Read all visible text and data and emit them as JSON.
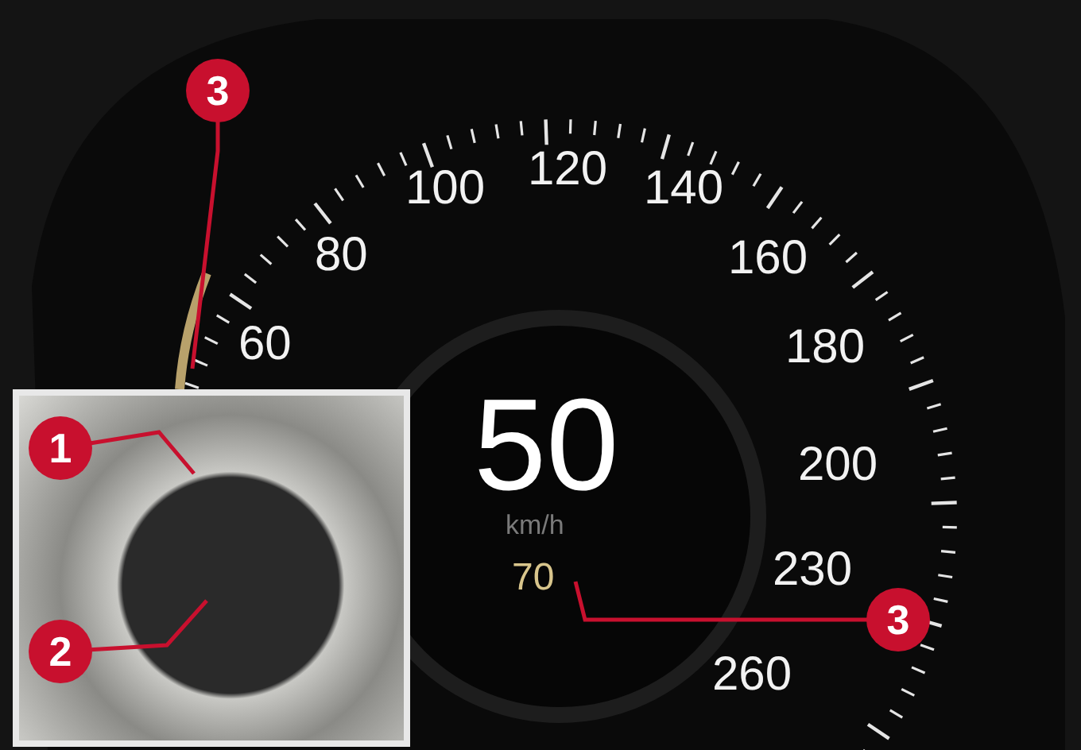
{
  "gauge": {
    "scale_labels": [
      "60",
      "80",
      "100",
      "120",
      "140",
      "160",
      "180",
      "200",
      "230",
      "260"
    ],
    "speed": "50",
    "unit": "km/h",
    "set_speed": "70"
  },
  "callouts": [
    {
      "number": "3"
    },
    {
      "number": "1"
    },
    {
      "number": "2"
    },
    {
      "number": "3"
    }
  ]
}
